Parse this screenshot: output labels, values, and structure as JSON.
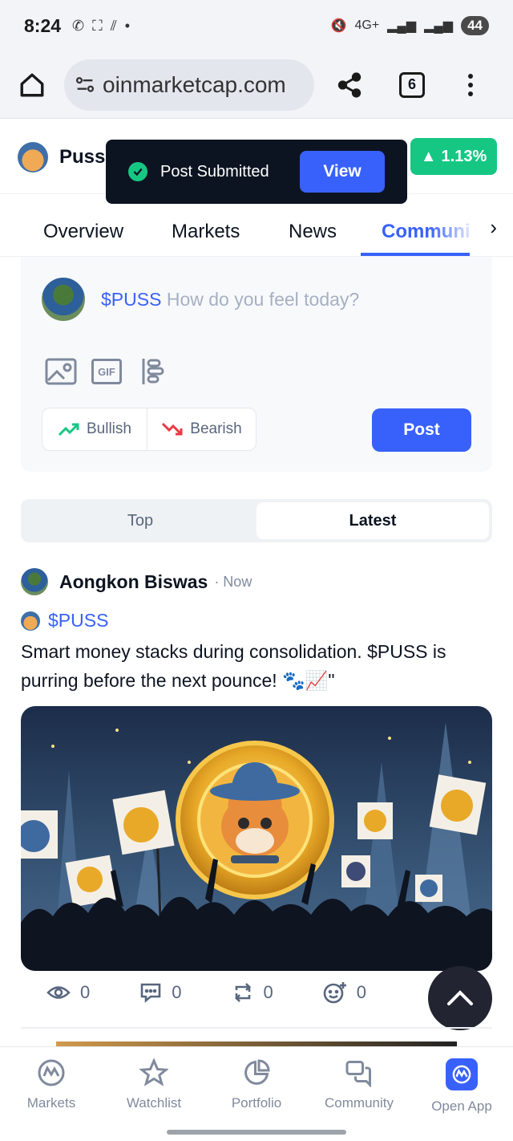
{
  "status_bar": {
    "time": "8:24",
    "network": "4G+",
    "battery": "44"
  },
  "browser": {
    "url": "oinmarketcap.com",
    "tab_count": "6"
  },
  "coin": {
    "name": "Puss",
    "price_change": "1.13%",
    "change_color": "#16c784"
  },
  "toast": {
    "message": "Post Submitted",
    "action": "View"
  },
  "tabs": [
    {
      "label": "Overview"
    },
    {
      "label": "Markets"
    },
    {
      "label": "News"
    },
    {
      "label": "Communi"
    }
  ],
  "composer": {
    "ticker": "$PUSS",
    "placeholder": "How do you feel today?",
    "gif_label": "GIF",
    "bullish": "Bullish",
    "bearish": "Bearish",
    "post": "Post"
  },
  "feed_filter": {
    "top": "Top",
    "latest": "Latest",
    "active": "Latest"
  },
  "post": {
    "author": "Aongkon Biswas",
    "time": "· Now",
    "ticker": "$PUSS",
    "body": "Smart money stacks during consolidation. $PUSS is purring before the next pounce! 🐾📈\"",
    "views": "0",
    "comments": "0",
    "reposts": "0",
    "reactions": "0"
  },
  "bottom_nav": [
    {
      "label": "Markets",
      "icon": "markets-icon"
    },
    {
      "label": "Watchlist",
      "icon": "star-icon"
    },
    {
      "label": "Portfolio",
      "icon": "pie-chart-icon"
    },
    {
      "label": "Community",
      "icon": "chat-bubbles-icon"
    },
    {
      "label": "Open App",
      "icon": "cmc-app-icon"
    }
  ],
  "colors": {
    "accent": "#3861fb",
    "positive": "#16c784",
    "negative": "#ea3943",
    "dark": "#0d1421"
  }
}
